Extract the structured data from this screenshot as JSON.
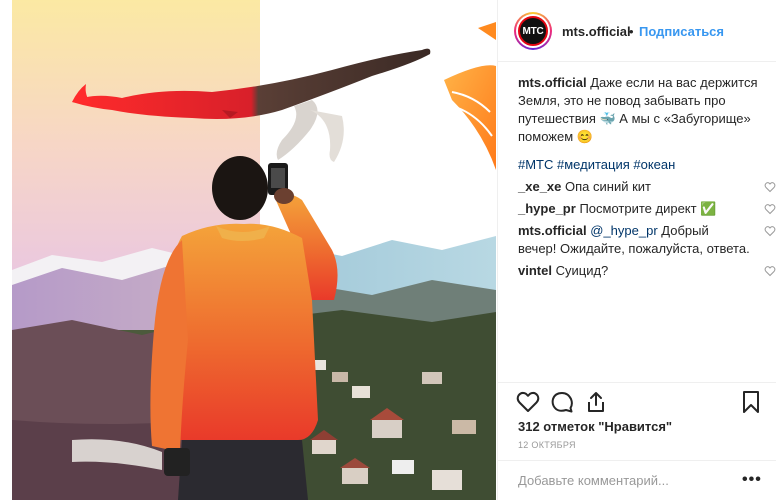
{
  "header": {
    "username": "mts.official",
    "dot": "•",
    "follow_label": "Подписаться",
    "avatar_text": "МТС"
  },
  "caption": {
    "username": "mts.official",
    "text": "Даже если на вас держится Земля, это не повод забывать про путешествия 🐳 А мы с «Забугорище» поможем 😊"
  },
  "hashtags": "#МТС #медитация #океан",
  "comments": [
    {
      "username": "_xe_xe",
      "text": "Опа синий кит"
    },
    {
      "username": "_hype_pr",
      "text": "Посмотрите директ ✅"
    },
    {
      "username": "mts.official",
      "mention": "@_hype_pr",
      "text": "Добрый вечер! Ожидайте, пожалуйста, ответа."
    },
    {
      "username": "vintel",
      "text": "Суицид?"
    }
  ],
  "likes": "312 отметок \"Нравится\"",
  "date": "12 октября",
  "add_comment_placeholder": "Добавьте комментарий...",
  "more_label": "•••",
  "icons": {
    "like": "heart-icon",
    "comment": "comment-icon",
    "share": "share-icon",
    "save": "bookmark-icon"
  },
  "colors": {
    "link": "#3897f0",
    "hashtag": "#003569",
    "muted": "#999999"
  }
}
